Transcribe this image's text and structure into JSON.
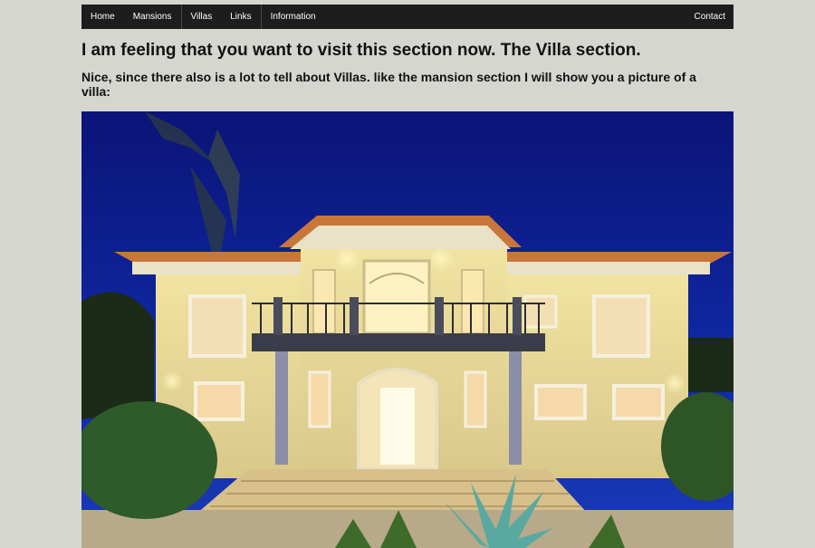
{
  "nav": {
    "items": [
      {
        "label": "Home"
      },
      {
        "label": "Mansions"
      },
      {
        "label": "Villas"
      },
      {
        "label": "Links"
      },
      {
        "label": "Information"
      }
    ],
    "contact_label": "Contact"
  },
  "main": {
    "heading": "I am feeling that you want to visit this section now. The Villa section.",
    "subheading": "Nice, since there also is a lot to tell about Villas. like the mansion section I will show you a picture of a villa:"
  },
  "photo": {
    "subject": "villa-photo",
    "colors": {
      "sky": "#0d1a8c",
      "wall": "#e9dd9a",
      "roof": "#c7743c",
      "light": "#fff3b0"
    }
  }
}
